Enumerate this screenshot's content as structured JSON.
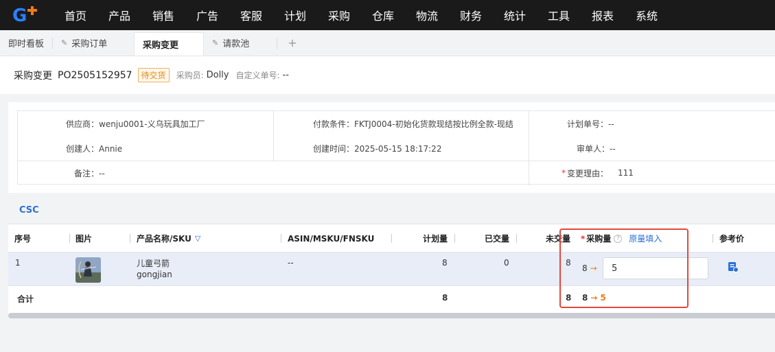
{
  "nav": {
    "items": [
      "首页",
      "产品",
      "销售",
      "广告",
      "客服",
      "计划",
      "采购",
      "仓库",
      "物流",
      "财务",
      "统计",
      "工具",
      "报表",
      "系统"
    ]
  },
  "tabs": {
    "dashboard": "即时看板",
    "purchase_order": "采购订单",
    "purchase_change": "采购变更",
    "payment_pool": "请款池",
    "add": "+"
  },
  "header": {
    "title": "采购变更",
    "po_number": "PO2505152957",
    "status": "待交货",
    "buyer_label": "采购员:",
    "buyer": "Dolly",
    "custom_no_label": "自定义单号:",
    "custom_no": "--"
  },
  "info": {
    "supplier": "供应商：wenju0001-义乌玩具加工厂",
    "payment_terms": "付款条件：FKTJ0004-初始化货款现结按比例全款-现结",
    "plan_no": "计划单号：--",
    "creator": "创建人：Annie",
    "created_at": "创建时间：2025-05-15 18:17:22",
    "reviewer": "审单人：--",
    "remark": "备注：--",
    "reason_label": "变更理由：",
    "reason_value": "111"
  },
  "section": {
    "csc": "CSC"
  },
  "table": {
    "headers": {
      "index": "序号",
      "image": "图片",
      "product": "产品名称/SKU",
      "asin": "ASIN/MSKU/FNSKU",
      "planned": "计划量",
      "delivered": "已交量",
      "undelivered": "未交量",
      "purchase_qty": "采购量",
      "fill_original": "原量填入",
      "ref_price": "参考价"
    },
    "rows": [
      {
        "index": "1",
        "name": "儿童弓箭",
        "sku": "gongjian",
        "asin": "--",
        "planned": "8",
        "delivered": "0",
        "undelivered": "8",
        "old_qty": "8",
        "arrow": "→",
        "new_qty": "5"
      }
    ],
    "summary": {
      "label": "合计",
      "planned": "8",
      "undelivered": "8",
      "old_qty": "8",
      "arrow": "→",
      "new_qty": "5"
    }
  },
  "colors": {
    "accent": "#2b6fd6",
    "warning": "#f07a1a",
    "highlight": "#e4463b",
    "navbg": "#1a1a1a"
  }
}
